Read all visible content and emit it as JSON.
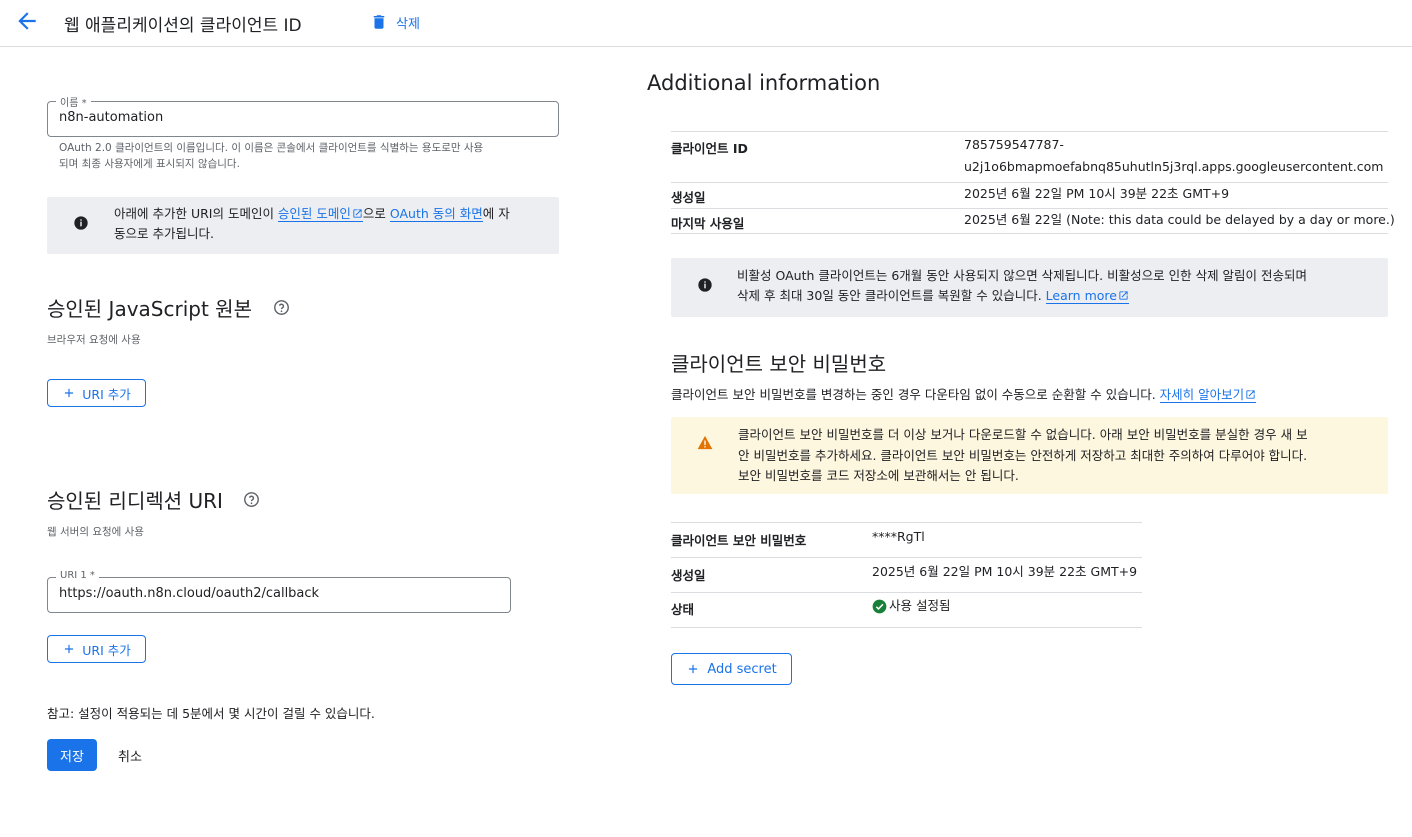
{
  "header": {
    "title": "웹 애플리케이션의 클라이언트 ID",
    "delete_label": "삭제"
  },
  "name_field": {
    "label": "이름 *",
    "value": "n8n-automation",
    "hint_line1": "OAuth 2.0 클라이언트의 이름입니다. 이 이름은 콘솔에서 클라이언트를 식별하는 용도로만 사용",
    "hint_line2": "되며 최종 사용자에게 표시되지 않습니다."
  },
  "domain_info": {
    "prefix": "아래에 추가한 URI의 도메인이 ",
    "link1": "승인된 도메인",
    "mid": "으로 ",
    "link2": "OAuth 동의 화면",
    "suffix1": "에 자",
    "line2": "동으로 추가됩니다."
  },
  "js_origins": {
    "title": "승인된 JavaScript 원본",
    "subtitle": "브라우저 요청에 사용",
    "add_uri_label": "URI 추가"
  },
  "redirect_uris": {
    "title": "승인된 리디렉션 URI",
    "subtitle": "웹 서버의 요청에 사용",
    "field_label": "URI 1 *",
    "field_value": "https://oauth.n8n.cloud/oauth2/callback",
    "add_uri_label": "URI 추가"
  },
  "footer": {
    "note": "참고: 설정이 적용되는 데 5분에서 몇 시간이 걸릴 수 있습니다.",
    "save_label": "저장",
    "cancel_label": "취소"
  },
  "additional_info": {
    "title": "Additional information",
    "rows": [
      {
        "key": "클라이언트 ID",
        "value_line1": "785759547787-",
        "value_line2": "u2j1o6bmapmoefabnq85uhutln5j3rql.apps.googleusercontent.com"
      },
      {
        "key": "생성일",
        "value": "2025년 6월 22일 PM 10시 39분 22초 GMT+9"
      },
      {
        "key": "마지막 사용일",
        "value": "2025년 6월 22일 (Note: this data could be delayed by a day or more.)"
      }
    ],
    "inactive_notice_line1": "비활성 OAuth 클라이언트는 6개월 동안 사용되지 않으면 삭제됩니다. 비활성으로 인한 삭제 알림이 전송되며",
    "inactive_notice_line2": "삭제 후 최대 30일 동안 클라이언트를 복원할 수 있습니다. ",
    "learn_more": "Learn more"
  },
  "client_secret": {
    "title": "클라이언트 보안 비밀번호",
    "description": "클라이언트 보안 비밀번호를 변경하는 중인 경우 다운타임 없이 수동으로 순환할 수 있습니다. ",
    "learn_link": "자세히 알아보기",
    "warning_line1": "클라이언트 보안 비밀번호를 더 이상 보거나 다운로드할 수 없습니다. 아래 보안 비밀번호를 분실한 경우 새 보",
    "warning_line2": "안 비밀번호를 추가하세요. 클라이언트 보안 비밀번호는 안전하게 저장하고 최대한 주의하여 다루어야 합니다.",
    "warning_line3": "보안 비밀번호를 코드 저장소에 보관해서는 안 됩니다.",
    "rows": [
      {
        "key": "클라이언트 보안 비밀번호",
        "value": "****RgTl"
      },
      {
        "key": "생성일",
        "value": "2025년 6월 22일 PM 10시 39분 22초 GMT+9"
      },
      {
        "key": "상태",
        "value": "사용 설정됨"
      }
    ],
    "add_secret_label": "Add secret"
  },
  "colors": {
    "accent": "#1a73e8",
    "info_bg": "#eceef2",
    "warning_bg": "#fef7e0",
    "warning_icon": "#e37400",
    "success": "#188038"
  }
}
